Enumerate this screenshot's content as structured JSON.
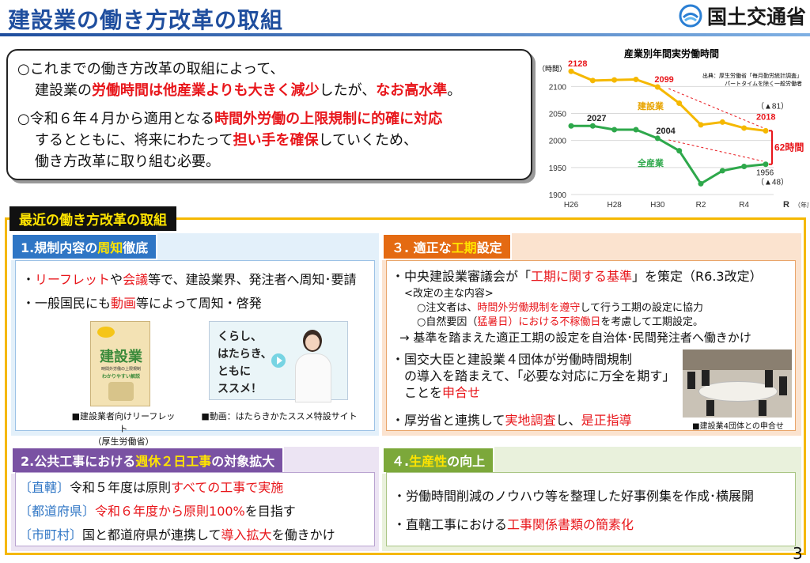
{
  "header": {
    "title": "建設業の働き方改革の取組",
    "org": "国土交通省",
    "page_number": "3"
  },
  "summary": {
    "l1": "○これまでの働き方改革の取組によって、",
    "l2_a": "建設業の",
    "l2_b": "労働時間は他産業よりも大きく減少",
    "l2_c": "したが、",
    "l2_d": "なお高水準",
    "l2_e": "。",
    "l3_a": "○令和６年４月から適用となる",
    "l3_b": "時間外労働の上限規制に的確に対応",
    "l4_a": "するとともに、将来にわたって",
    "l4_b": "担い手を確保",
    "l4_c": "していくため、",
    "l5": "働き方改革に取り組む必要。"
  },
  "chart_data": {
    "type": "line",
    "title": "産業別年間実労働時間",
    "ylabel": "（時間）",
    "xlabel": "（年度）",
    "source_note_1": "出典：厚生労働省「毎月勤労統計調査」",
    "source_note_2": "パートタイムを除く一般労働者",
    "x_ticks": [
      "H26",
      "H28",
      "H30",
      "R2",
      "R4",
      "R"
    ],
    "y_ticks": [
      "2100",
      "2050",
      "2000",
      "1950",
      "1900"
    ],
    "ylim": [
      1900,
      2140
    ],
    "x": [
      "H26",
      "H27",
      "H28",
      "H29",
      "H30",
      "R1",
      "R2",
      "R3",
      "R4",
      "R5"
    ],
    "series": [
      {
        "name": "建設業",
        "color": "#f5b800",
        "values": [
          2128,
          2111,
          2112,
          2113,
          2099,
          2069,
          2029,
          2034,
          2023,
          2018
        ]
      },
      {
        "name": "全産業",
        "color": "#2ea84b",
        "values": [
          2027,
          2027,
          2020,
          2020,
          2004,
          1981,
          1920,
          1944,
          1952,
          1956
        ]
      }
    ],
    "annotations": {
      "c_start": "2128",
      "c_h30": "2099",
      "c_end": "2018",
      "c_diff": "（▲81）",
      "a_start": "2027",
      "a_h30": "2004",
      "a_end": "1956",
      "a_diff": "（▲48）",
      "gap": "62時間"
    }
  },
  "main": {
    "heading": "最近の働き方改革の取組",
    "p1": {
      "tag_a": "1.規制内容の",
      "tag_b": "周知",
      "tag_c": "徹底",
      "b1_a": "リーフレット",
      "b1_b": "や",
      "b1_c": "会議",
      "b1_d": "等で、建設業界、発注者へ周知･要請",
      "b2_a": "一般国民にも",
      "b2_b": "動画",
      "b2_c": "等によって周知・啓発",
      "leaflet_title": "建設業",
      "leaflet_sub1": "時間外労働の上限規制",
      "leaflet_sub2": "わかりやすい解説",
      "cap1_a": "■建設業者向けリーフレット",
      "cap1_b": "（厚生労働省）",
      "video_l1": "くらし、",
      "video_l2": "はたらき、",
      "video_l3": "ともに",
      "video_l4": "ススメ！",
      "cap2": "■動画：はたらきかたススメ特設サイト"
    },
    "p2": {
      "tag_a": "2.公共工事における",
      "tag_b": "週休２日工事",
      "tag_c": "の対象拡大",
      "r1_k": "〔直轄〕",
      "r1_a": "令和５年度は原則",
      "r1_b": "すべての工事で実施",
      "r2_k": "〔都道府県〕",
      "r2_a": "令和６年度から原則100%",
      "r2_b": "を目指す",
      "r3_k": "〔市町村〕",
      "r3_a": "国と都道府県が連携して",
      "r3_b": "導入拡大",
      "r3_c": "を働きかけ"
    },
    "p3": {
      "tag_a": "３. 適正な",
      "tag_b": "工期",
      "tag_c": "設定",
      "b1_a": "中央建設業審議会が「",
      "b1_b": "工期に関する基準",
      "b1_c": "」を策定（R6.3改定）",
      "sub_head": "<改定の主な内容>",
      "sub1_a": "○注文者は、",
      "sub1_b": "時間外労働規制を遵守",
      "sub1_c": "して行う工期の設定に協力",
      "sub2_a": "○自然要因（",
      "sub2_b": "猛暑日）における不稼働日",
      "sub2_c": "を考慮して工期設定。",
      "arrow": "→ 基準を踏まえた適正工期の設定を自治体･民間発注者へ働きかけ",
      "b2_l1": "国交大臣と建設業４団体が労働時間規制",
      "b2_l2": "の導入を踏まえて、「必要な対応に万全を期す」",
      "b2_l3_a": "ことを",
      "b2_l3_b": "申合せ",
      "b3_a": "厚労省と連携して",
      "b3_b": "実地調査",
      "b3_c": "し、",
      "b3_d": "是正指導",
      "photo_cap": "■建設業4団体との申合せ"
    },
    "p4": {
      "tag_a": "４.",
      "tag_b": "生産性",
      "tag_c": "の向上",
      "b1": "労働時間削減のノウハウ等を整理した好事例集を作成･横展開",
      "b2_a": "直轄工事における",
      "b2_b": "工事関係書類の簡素化"
    }
  }
}
